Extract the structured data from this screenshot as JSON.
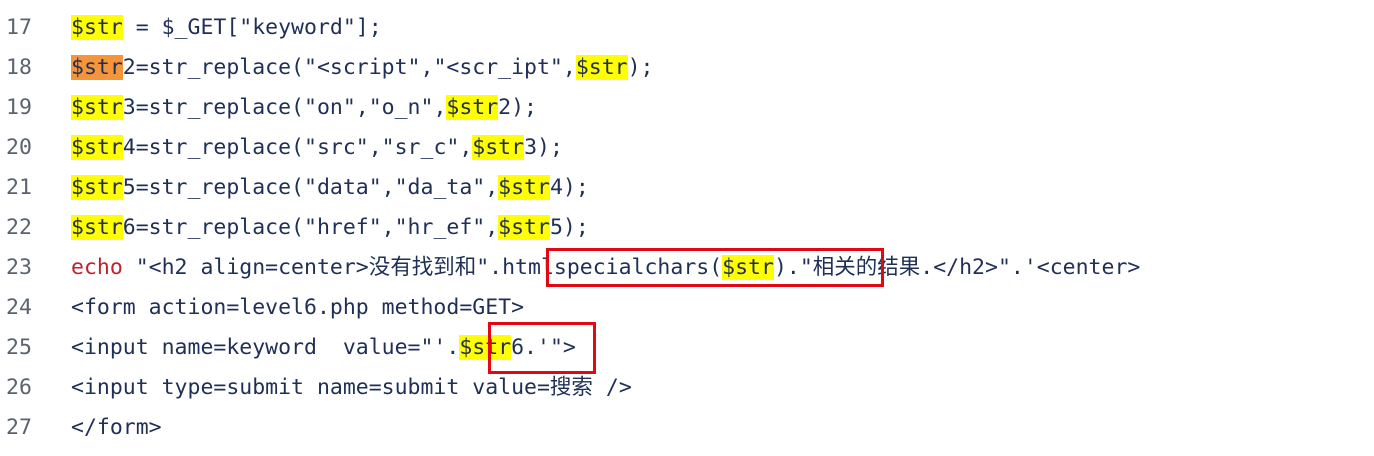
{
  "editor": {
    "lines": [
      {
        "number": "17",
        "segments": [
          {
            "text": "$str",
            "style": "hl"
          },
          {
            "text": " = $_GET[\"keyword\"];",
            "style": ""
          }
        ]
      },
      {
        "number": "18",
        "segments": [
          {
            "text": "$str",
            "style": "hl-cur"
          },
          {
            "text": "2=str_replace(\"<script\",\"<scr_ipt\",",
            "style": ""
          },
          {
            "text": "$str",
            "style": "hl"
          },
          {
            "text": ");",
            "style": ""
          }
        ]
      },
      {
        "number": "19",
        "segments": [
          {
            "text": "$str",
            "style": "hl"
          },
          {
            "text": "3=str_replace(\"on\",\"o_n\",",
            "style": ""
          },
          {
            "text": "$str",
            "style": "hl"
          },
          {
            "text": "2);",
            "style": ""
          }
        ]
      },
      {
        "number": "20",
        "segments": [
          {
            "text": "$str",
            "style": "hl"
          },
          {
            "text": "4=str_replace(\"src\",\"sr_c\",",
            "style": ""
          },
          {
            "text": "$str",
            "style": "hl"
          },
          {
            "text": "3);",
            "style": ""
          }
        ]
      },
      {
        "number": "21",
        "segments": [
          {
            "text": "$str",
            "style": "hl"
          },
          {
            "text": "5=str_replace(\"data\",\"da_ta\",",
            "style": ""
          },
          {
            "text": "$str",
            "style": "hl"
          },
          {
            "text": "4);",
            "style": ""
          }
        ]
      },
      {
        "number": "22",
        "segments": [
          {
            "text": "$str",
            "style": "hl"
          },
          {
            "text": "6=str_replace(\"href\",\"hr_ef\",",
            "style": ""
          },
          {
            "text": "$str",
            "style": "hl"
          },
          {
            "text": "5);",
            "style": ""
          }
        ]
      },
      {
        "number": "23",
        "segments": [
          {
            "text": "echo",
            "style": "kw"
          },
          {
            "text": " \"<h2 align=center>没有找到和\".htmlspecialchars(",
            "style": ""
          },
          {
            "text": "$str",
            "style": "hl"
          },
          {
            "text": ").\"相关的结果.</h2>\".'<center>",
            "style": ""
          }
        ]
      },
      {
        "number": "24",
        "segments": [
          {
            "text": "<form action=level6.php method=GET>",
            "style": ""
          }
        ]
      },
      {
        "number": "25",
        "segments": [
          {
            "text": "<input name=keyword  value=\"'.",
            "style": ""
          },
          {
            "text": "$str",
            "style": "hl"
          },
          {
            "text": "6.'\">",
            "style": ""
          }
        ]
      },
      {
        "number": "26",
        "segments": [
          {
            "text": "<input type=submit name=submit value=搜索 />",
            "style": ""
          }
        ]
      },
      {
        "number": "27",
        "segments": [
          {
            "text": "</form>",
            "style": ""
          }
        ]
      }
    ]
  },
  "annotations": {
    "colors": {
      "box_border": "#e30613",
      "highlight": "#ffff00",
      "current_highlight": "#f5953b",
      "keyword": "#c0222c",
      "code_text": "#1f2f56",
      "line_number": "#5a6270"
    }
  }
}
